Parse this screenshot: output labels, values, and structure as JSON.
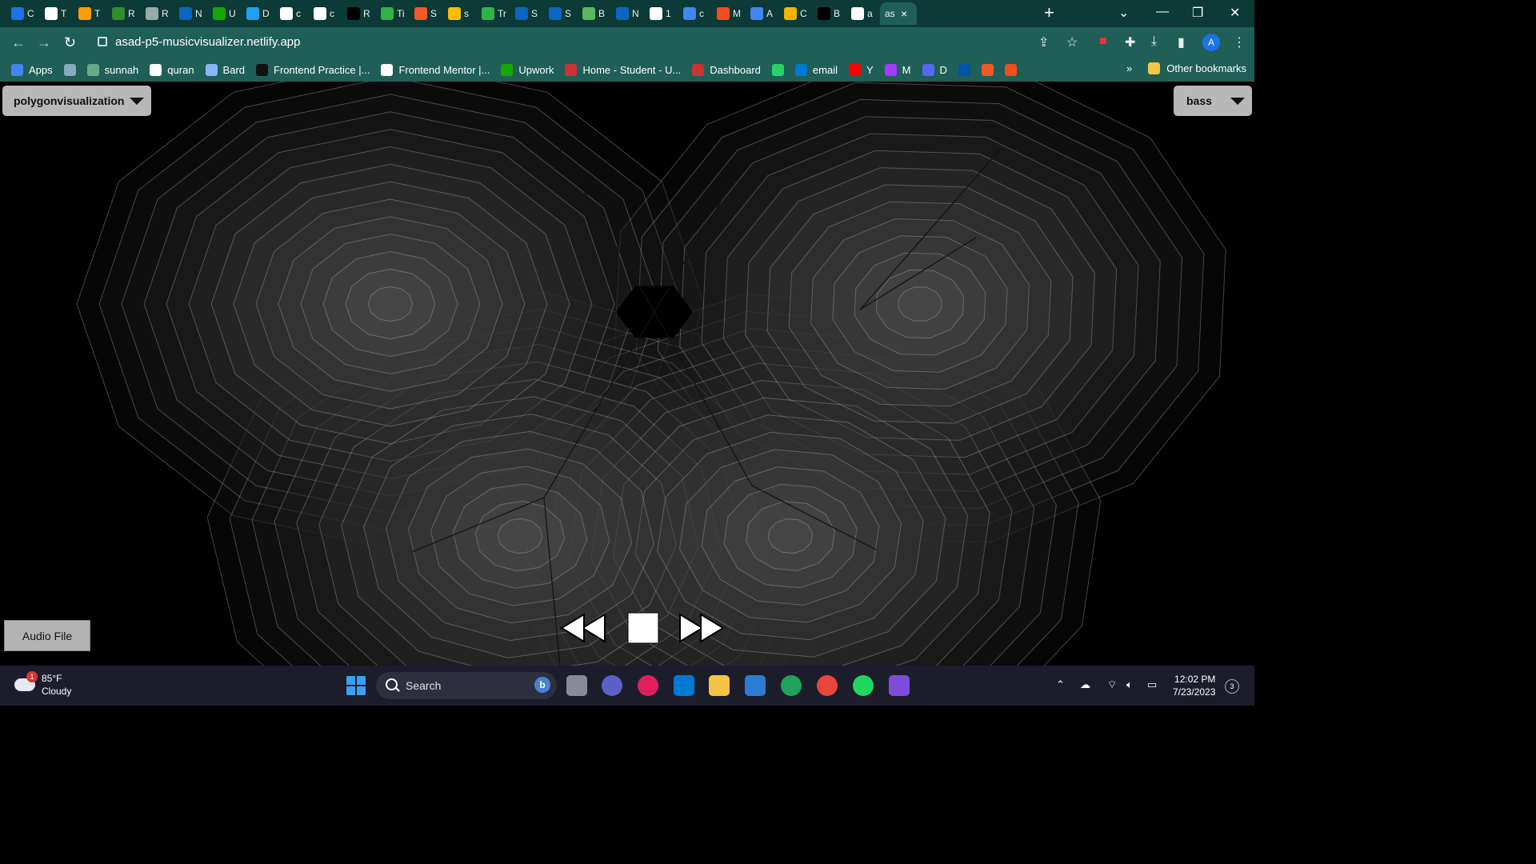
{
  "browser": {
    "tabs": [
      {
        "label": "C",
        "icon": "c-icon",
        "color": "#1a73e8"
      },
      {
        "label": "T",
        "icon": "globe-icon",
        "color": "#ffffff"
      },
      {
        "label": "T",
        "icon": "chatgpt-icon",
        "color": "#ff9d00"
      },
      {
        "label": "R",
        "icon": "w-icon",
        "color": "#2f8f2f"
      },
      {
        "label": "R",
        "icon": "openai-icon",
        "color": "#9aa"
      },
      {
        "label": "N",
        "icon": "linkedin-icon",
        "color": "#0a66c2"
      },
      {
        "label": "U",
        "icon": "upwork-icon",
        "color": "#14a800"
      },
      {
        "label": "D",
        "icon": "d-icon",
        "color": "#1da1f2"
      },
      {
        "label": "c",
        "icon": "github-icon",
        "color": "#ffffff"
      },
      {
        "label": "c",
        "icon": "square-icon",
        "color": "#ffffff"
      },
      {
        "label": "R",
        "icon": "r-icon",
        "color": "#000000"
      },
      {
        "label": "Ti",
        "icon": "px-icon",
        "color": "#2fb344"
      },
      {
        "label": "S",
        "icon": "s-icon",
        "color": "#f05a28"
      },
      {
        "label": "s",
        "icon": "drive-icon",
        "color": "#fbbc04"
      },
      {
        "label": "Tr",
        "icon": "px-icon",
        "color": "#2fb344"
      },
      {
        "label": "S",
        "icon": "linkedin-icon",
        "color": "#0a66c2"
      },
      {
        "label": "S",
        "icon": "linkedin-icon",
        "color": "#0a66c2"
      },
      {
        "label": "B",
        "icon": "b-icon",
        "color": "#5cb85c"
      },
      {
        "label": "N",
        "icon": "linkedin-icon",
        "color": "#0a66c2"
      },
      {
        "label": "1",
        "icon": "google-icon",
        "color": "#ffffff"
      },
      {
        "label": "c",
        "icon": "docs-icon",
        "color": "#4285f4"
      },
      {
        "label": "M",
        "icon": "figma-icon",
        "color": "#f24e1e"
      },
      {
        "label": "A",
        "icon": "docs-icon",
        "color": "#4285f4"
      },
      {
        "label": "C",
        "icon": "c-icon",
        "color": "#f4b400"
      },
      {
        "label": "B",
        "icon": "b-icon",
        "color": "#000000"
      },
      {
        "label": "a",
        "icon": "globe-icon",
        "color": "#ffffff"
      }
    ],
    "active_tab": {
      "label": "as",
      "icon": "globe-icon"
    },
    "url": "asad-p5-musicvisualizer.netlify.app",
    "profile_initial": "A",
    "bookmarks": [
      {
        "label": "Apps",
        "icon": "apps-icon",
        "color": "#4285f4"
      },
      {
        "label": "",
        "icon": "image-icon",
        "color": "#8ab"
      },
      {
        "label": "sunnah",
        "icon": "sunnah-icon",
        "color": "#6a8"
      },
      {
        "label": "quran",
        "icon": "globe-icon",
        "color": "#fff"
      },
      {
        "label": "Bard",
        "icon": "bard-icon",
        "color": "#8ab4f8"
      },
      {
        "label": "Frontend Practice |...",
        "icon": "fp-icon",
        "color": "#111"
      },
      {
        "label": "Frontend Mentor |...",
        "icon": "fm-icon",
        "color": "#fff"
      },
      {
        "label": "Upwork",
        "icon": "upwork-icon",
        "color": "#14a800"
      },
      {
        "label": "Home - Student - U...",
        "icon": "uni-icon",
        "color": "#c33"
      },
      {
        "label": "Dashboard",
        "icon": "uni-icon",
        "color": "#c33"
      },
      {
        "label": "",
        "icon": "whatsapp-icon",
        "color": "#25d366"
      },
      {
        "label": "email",
        "icon": "outlook-icon",
        "color": "#0078d4"
      },
      {
        "label": "Y",
        "icon": "youtube-icon",
        "color": "#ff0000"
      },
      {
        "label": "M",
        "icon": "messenger-icon",
        "color": "#a33bff"
      },
      {
        "label": "D",
        "icon": "discord-icon",
        "color": "#5865f2"
      },
      {
        "label": "",
        "icon": "mega-icon",
        "color": "#0055aa"
      },
      {
        "label": "",
        "icon": "s-icon",
        "color": "#f05a28"
      },
      {
        "label": "",
        "icon": "figma-icon",
        "color": "#f24e1e"
      }
    ],
    "bookmarks_overflow": "»",
    "other_bookmarks": "Other bookmarks"
  },
  "app": {
    "visualization_select": "polygonvisualization",
    "band_select": "bass",
    "audio_button": "Audio File",
    "controls": {
      "rewind": "rewind-icon",
      "stop": "stop-icon",
      "forward": "fast-forward-icon"
    },
    "colors": {
      "background": "#000000",
      "polygon": "#5a5a5a",
      "button": "#b8b8b8"
    }
  },
  "taskbar": {
    "weather_temp": "85°F",
    "weather_desc": "Cloudy",
    "weather_badge": "1",
    "search_label": "Search",
    "time": "12:02 PM",
    "date": "7/23/2023",
    "notifications": "3"
  }
}
